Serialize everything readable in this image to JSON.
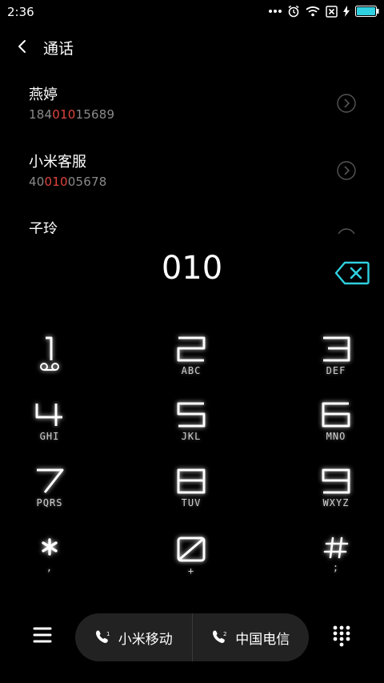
{
  "status_bar": {
    "time": "2:36"
  },
  "header": {
    "title": "通话"
  },
  "contacts": [
    {
      "name": "燕婷",
      "number_pre": "184",
      "number_match": "010",
      "number_post": "15689"
    },
    {
      "name": "小米客服",
      "number_pre": "40",
      "number_match": "010",
      "number_post": "05678"
    },
    {
      "name": "子玲"
    }
  ],
  "dialer": {
    "entered_number": "010"
  },
  "keypad": [
    {
      "digit": "1",
      "letters": ""
    },
    {
      "digit": "2",
      "letters": "ABC"
    },
    {
      "digit": "3",
      "letters": "DEF"
    },
    {
      "digit": "4",
      "letters": "GHI"
    },
    {
      "digit": "5",
      "letters": "JKL"
    },
    {
      "digit": "6",
      "letters": "MNO"
    },
    {
      "digit": "7",
      "letters": "PQRS"
    },
    {
      "digit": "8",
      "letters": "TUV"
    },
    {
      "digit": "9",
      "letters": "WXYZ"
    },
    {
      "digit": "*",
      "letters": ","
    },
    {
      "digit": "0",
      "letters": "+"
    },
    {
      "digit": "#",
      "letters": ";"
    }
  ],
  "sim_buttons": [
    {
      "slot": "1",
      "label": "小米移动"
    },
    {
      "slot": "2",
      "label": "中国电信"
    }
  ],
  "colors": {
    "accent": "#2fd0e0",
    "match_highlight": "#e0443c",
    "pill_bg": "#222222",
    "secondary_text": "#8a8a8a"
  },
  "icons": [
    "more-dots-icon",
    "alarm-icon",
    "wifi-icon",
    "sim-none-icon",
    "charging-icon",
    "battery-icon",
    "back-arrow-icon",
    "chevron-right-circle-icon",
    "backspace-icon",
    "voicemail-icon",
    "menu-icon",
    "phone-icon",
    "dialpad-icon"
  ]
}
